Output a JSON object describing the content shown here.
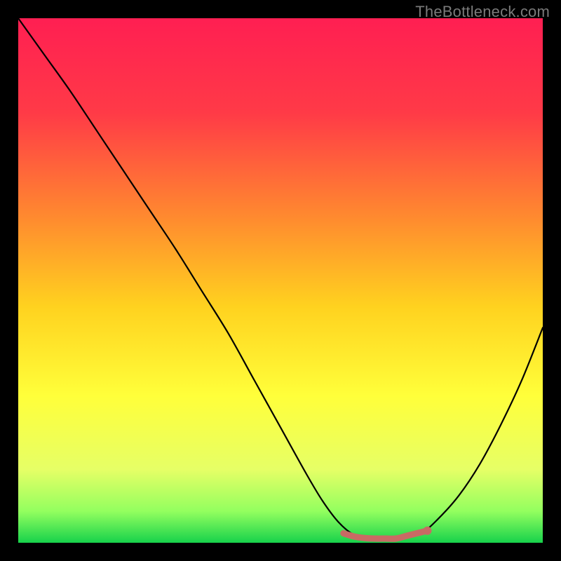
{
  "watermark": "TheBottleneck.com",
  "chart_data": {
    "type": "line",
    "title": "",
    "xlabel": "",
    "ylabel": "",
    "xlim": [
      0,
      100
    ],
    "ylim": [
      0,
      100
    ],
    "gradient_stops": [
      {
        "offset": 0,
        "color": "#ff1f52"
      },
      {
        "offset": 18,
        "color": "#ff3a47"
      },
      {
        "offset": 38,
        "color": "#ff8a2f"
      },
      {
        "offset": 55,
        "color": "#ffd21f"
      },
      {
        "offset": 72,
        "color": "#ffff3a"
      },
      {
        "offset": 86,
        "color": "#e6ff66"
      },
      {
        "offset": 94,
        "color": "#93ff5f"
      },
      {
        "offset": 100,
        "color": "#17d24b"
      }
    ],
    "series": [
      {
        "name": "bottleneck-curve",
        "color": "#000000",
        "x": [
          0,
          5,
          10,
          15,
          20,
          25,
          30,
          35,
          40,
          45,
          50,
          55,
          58,
          61,
          64,
          67,
          70,
          73,
          77,
          80,
          84,
          88,
          92,
          96,
          100
        ],
        "y": [
          100,
          93,
          86,
          78.5,
          71,
          63.5,
          56,
          48,
          40,
          31,
          22,
          13,
          8,
          4,
          1.5,
          0.7,
          0.7,
          0.8,
          2,
          4.5,
          9,
          15,
          22.5,
          31,
          41
        ]
      },
      {
        "name": "optimal-band",
        "color": "#c96a64",
        "x": [
          62,
          64,
          66,
          68,
          70,
          72,
          74,
          76,
          78
        ],
        "y": [
          1.8,
          1.2,
          0.9,
          0.8,
          0.8,
          0.8,
          1.3,
          1.8,
          2.3
        ]
      }
    ],
    "optimal_marker": {
      "x": 78,
      "y": 2.3,
      "color": "#c96a64"
    }
  }
}
